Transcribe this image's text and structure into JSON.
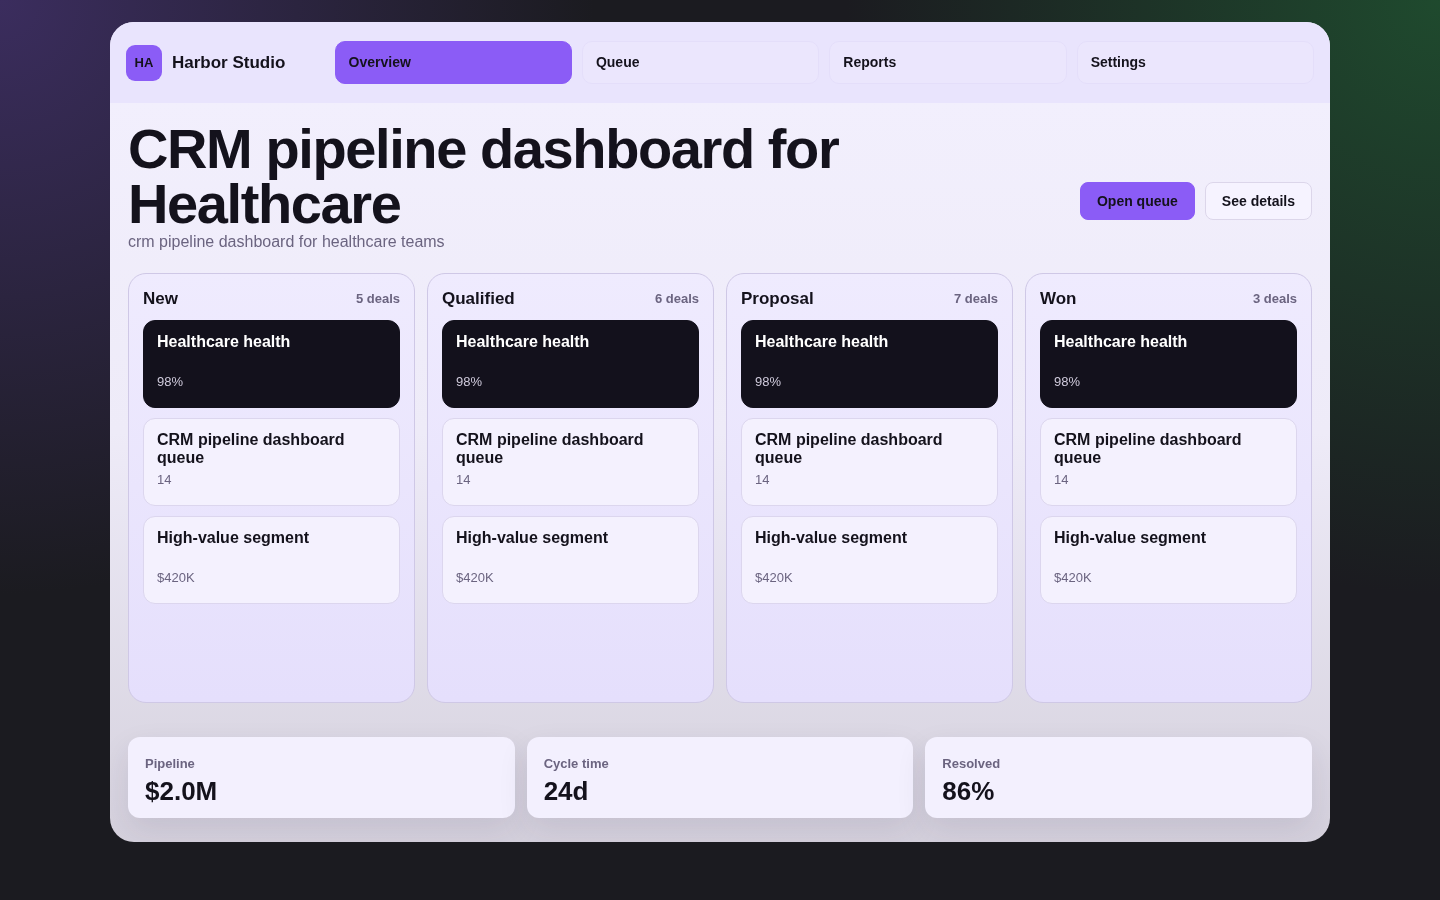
{
  "brand": {
    "initials": "HA",
    "name": "Harbor Studio"
  },
  "nav": {
    "tabs": [
      {
        "label": "Overview",
        "selected": true
      },
      {
        "label": "Queue",
        "selected": false
      },
      {
        "label": "Reports",
        "selected": false
      },
      {
        "label": "Settings",
        "selected": false
      }
    ]
  },
  "header": {
    "title": "CRM pipeline dashboard for Healthcare",
    "subtitle": "crm pipeline dashboard for healthcare teams",
    "actions": [
      {
        "label": "Open queue",
        "kind": "primary"
      },
      {
        "label": "See details",
        "kind": "secondary"
      }
    ]
  },
  "board": {
    "columns": [
      {
        "title": "New",
        "count": "5 deals",
        "cards": [
          {
            "title": "Healthcare health",
            "value": "98%",
            "highlighted": true
          },
          {
            "title": "CRM pipeline dashboard queue",
            "value": "14",
            "highlighted": false
          },
          {
            "title": "High-value segment",
            "value": "$420K",
            "highlighted": false
          }
        ]
      },
      {
        "title": "Qualified",
        "count": "6 deals",
        "cards": [
          {
            "title": "Healthcare health",
            "value": "98%",
            "highlighted": true
          },
          {
            "title": "CRM pipeline dashboard queue",
            "value": "14",
            "highlighted": false
          },
          {
            "title": "High-value segment",
            "value": "$420K",
            "highlighted": false
          }
        ]
      },
      {
        "title": "Proposal",
        "count": "7 deals",
        "cards": [
          {
            "title": "Healthcare health",
            "value": "98%",
            "highlighted": true
          },
          {
            "title": "CRM pipeline dashboard queue",
            "value": "14",
            "highlighted": false
          },
          {
            "title": "High-value segment",
            "value": "$420K",
            "highlighted": false
          }
        ]
      },
      {
        "title": "Won",
        "count": "3 deals",
        "cards": [
          {
            "title": "Healthcare health",
            "value": "98%",
            "highlighted": true
          },
          {
            "title": "CRM pipeline dashboard queue",
            "value": "14",
            "highlighted": false
          },
          {
            "title": "High-value segment",
            "value": "$420K",
            "highlighted": false
          }
        ]
      }
    ]
  },
  "stats": [
    {
      "label": "Pipeline",
      "value": "$2.0M"
    },
    {
      "label": "Cycle time",
      "value": "24d"
    },
    {
      "label": "Resolved",
      "value": "86%"
    }
  ]
}
